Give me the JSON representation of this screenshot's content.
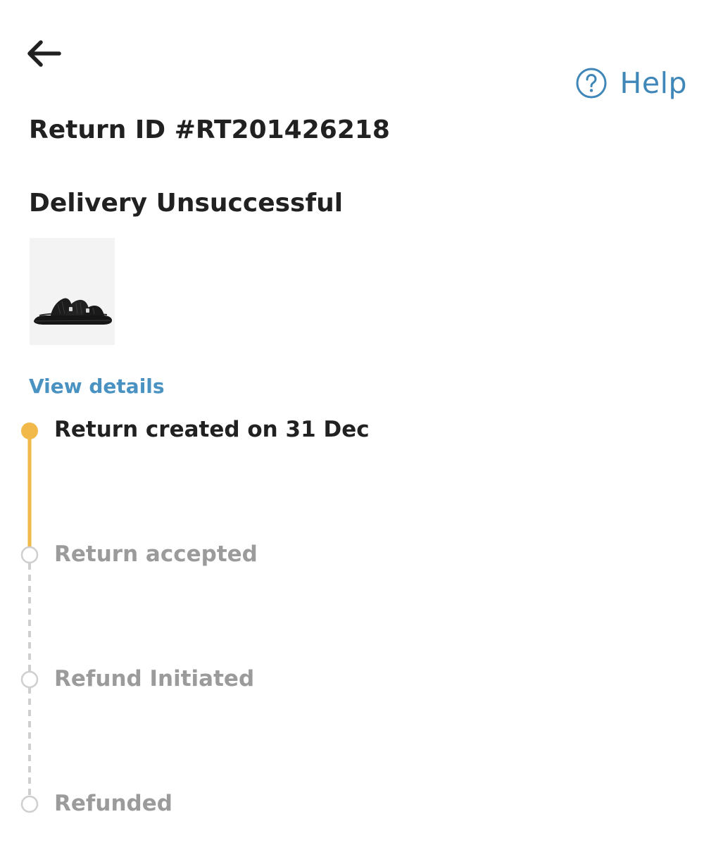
{
  "header": {
    "back_icon": "arrow-left-icon",
    "help_icon": "question-circle-icon",
    "help_label": "Help"
  },
  "return": {
    "id_label": "Return ID #RT201426218",
    "status": "Delivery Unsuccessful",
    "product_image": "black-sandal-thumbnail",
    "view_details": "View details"
  },
  "timeline": {
    "steps": [
      {
        "label": "Return created on 31 Dec",
        "state": "completed"
      },
      {
        "label": "Return accepted",
        "state": "pending"
      },
      {
        "label": "Refund Initiated",
        "state": "pending"
      },
      {
        "label": "Refunded",
        "state": "pending"
      }
    ],
    "colors": {
      "completed": "#f0b94a",
      "pending": "#cfcfcf"
    }
  },
  "colors": {
    "accent": "#3f87b8",
    "link": "#4a92c2",
    "text_primary": "#212121",
    "text_muted": "#9b9b9b"
  }
}
